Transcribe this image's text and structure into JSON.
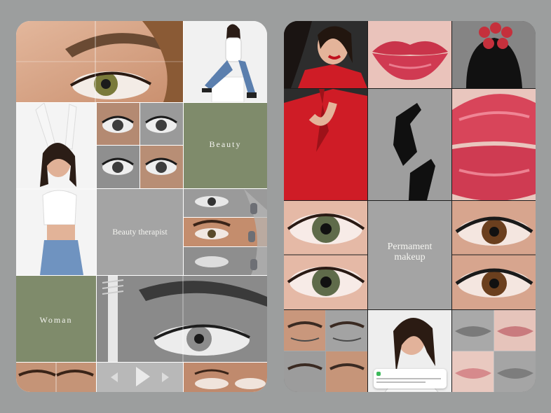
{
  "left_grid": {
    "beauty_label": "Beauty",
    "therapist_label": "Beauty therapist",
    "woman_label": "Woman"
  },
  "right_grid": {
    "permanent_label": "Permament makeup"
  },
  "colors": {
    "sage": "#7f8b6b",
    "gray_tile": "#a4a4a4",
    "red": "#d21e2a",
    "lip": "#c9344a"
  }
}
